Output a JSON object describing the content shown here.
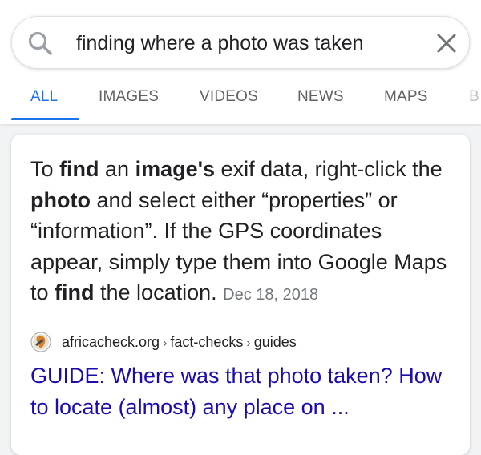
{
  "search": {
    "query": "finding where a photo was taken",
    "search_icon": "search-icon",
    "clear_icon": "close-icon"
  },
  "tabs": [
    {
      "label": "ALL",
      "active": true
    },
    {
      "label": "IMAGES"
    },
    {
      "label": "VIDEOS"
    },
    {
      "label": "NEWS"
    },
    {
      "label": "MAPS"
    },
    {
      "label": "B"
    }
  ],
  "featured_snippet": {
    "text_parts": [
      {
        "text": "To ",
        "bold": false
      },
      {
        "text": "find",
        "bold": true
      },
      {
        "text": " an ",
        "bold": false
      },
      {
        "text": "image's",
        "bold": true
      },
      {
        "text": " exif data, right-click the ",
        "bold": false
      },
      {
        "text": "photo",
        "bold": true
      },
      {
        "text": " and select either “properties” or “information”. If the GPS coordinates appear, simply type them into Google Maps to ",
        "bold": false
      },
      {
        "text": "find",
        "bold": true
      },
      {
        "text": " the location.",
        "bold": false
      }
    ],
    "date": "Dec 18, 2018",
    "source": {
      "domain": "africacheck.org",
      "path": [
        "fact-checks",
        "guides"
      ],
      "favicon": "africacheck-favicon"
    },
    "result_title": "GUIDE: Where was that photo taken? How to locate (almost) any place on ..."
  },
  "colors": {
    "accent": "#1a73e8",
    "link": "#1a0dab",
    "text": "#202124",
    "muted": "#70757a",
    "background": "#f1f3f4"
  }
}
